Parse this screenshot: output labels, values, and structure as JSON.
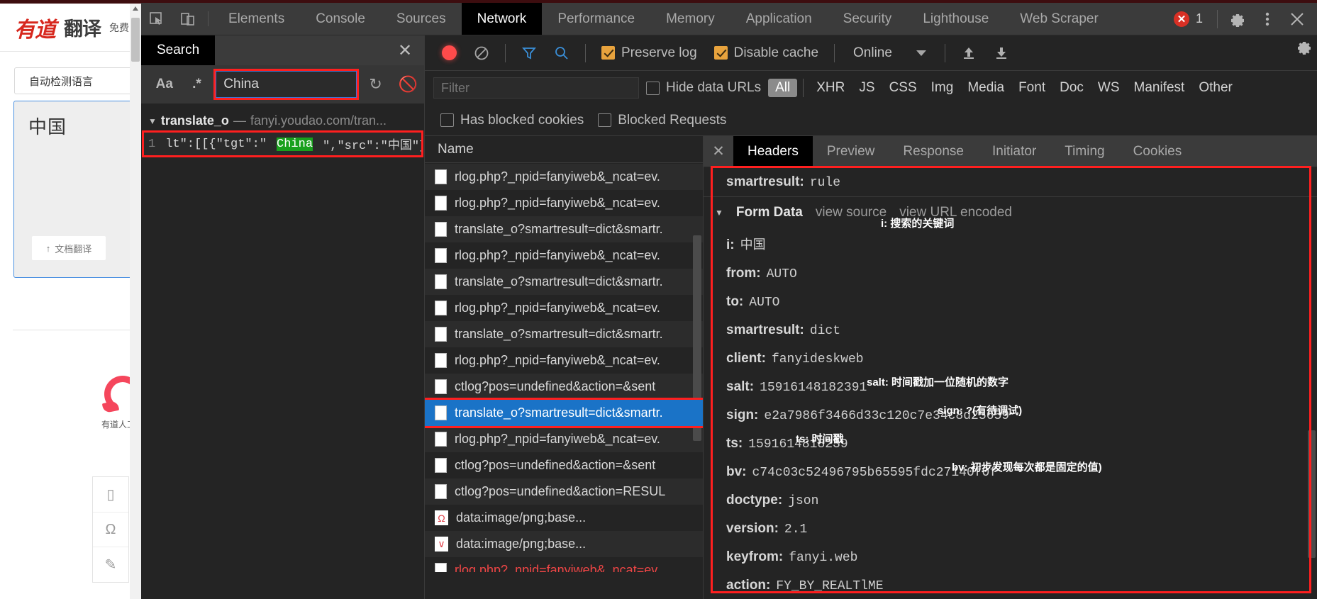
{
  "translate_page": {
    "logo_brand": "有道",
    "logo_word": "翻译",
    "logo_sub": "免费",
    "language_select": "自动检测语言",
    "source_text": "中国",
    "doc_translate_label": "文档翻译",
    "doc_translate_icon": "upload-icon",
    "human_translate_label": "有道人工翻",
    "side_tools": [
      "phone-icon",
      "headset-icon",
      "edit-icon"
    ]
  },
  "devtools": {
    "inspect_icon": "inspect-element-icon",
    "device_icon": "device-toolbar-icon",
    "tabs": [
      {
        "label": "Elements",
        "active": false
      },
      {
        "label": "Console",
        "active": false
      },
      {
        "label": "Sources",
        "active": false
      },
      {
        "label": "Network",
        "active": true
      },
      {
        "label": "Performance",
        "active": false
      },
      {
        "label": "Memory",
        "active": false
      },
      {
        "label": "Application",
        "active": false
      },
      {
        "label": "Security",
        "active": false
      },
      {
        "label": "Lighthouse",
        "active": false
      },
      {
        "label": "Web Scraper",
        "active": false
      }
    ],
    "error_count": "1",
    "settings_icon": "gear-icon",
    "more_icon": "kebab-menu-icon",
    "close_icon": "close-icon"
  },
  "search_panel": {
    "title": "Search",
    "close_icon": "close-icon",
    "match_case_label": "Aa",
    "regex_label": ".*",
    "query": "China",
    "placeholder": "",
    "refresh_icon": "refresh-icon",
    "clear_icon": "clear-icon",
    "result_file": "translate_o",
    "result_dash": "—",
    "result_url": "fanyi.youdao.com/tran...",
    "result_line_no": "1",
    "result_code_prefix": "lt\":[[{\"tgt\":\"",
    "result_match": "China",
    "result_code_suffix": "\",\"src\":\"中国\"}]],\""
  },
  "network": {
    "record_icon": "record-stop-icon",
    "clear_icon": "clear-icon",
    "filter_icon": "funnel-icon",
    "search_icon": "search-icon",
    "preserve_log_label": "Preserve log",
    "preserve_log_checked": true,
    "disable_cache_label": "Disable cache",
    "disable_cache_checked": true,
    "throttle_value": "Online",
    "import_icon": "upload-har-icon",
    "export_icon": "download-har-icon",
    "filter_placeholder": "Filter",
    "filter_value": "",
    "hide_data_urls_label": "Hide data URLs",
    "hide_data_urls_checked": false,
    "types": [
      "All",
      "XHR",
      "JS",
      "CSS",
      "Img",
      "Media",
      "Font",
      "Doc",
      "WS",
      "Manifest",
      "Other"
    ],
    "selected_type": "All",
    "has_blocked_cookies_label": "Has blocked cookies",
    "has_blocked_cookies_checked": false,
    "blocked_requests_label": "Blocked Requests",
    "blocked_requests_checked": false,
    "column_name": "Name",
    "requests": [
      {
        "name": "rlog.php?_npid=fanyiweb&_ncat=ev.",
        "icon": "doc-icon",
        "selected": false,
        "error": false
      },
      {
        "name": "rlog.php?_npid=fanyiweb&_ncat=ev.",
        "icon": "doc-icon",
        "selected": false,
        "error": false
      },
      {
        "name": "translate_o?smartresult=dict&smartr.",
        "icon": "doc-icon",
        "selected": false,
        "error": false
      },
      {
        "name": "rlog.php?_npid=fanyiweb&_ncat=ev.",
        "icon": "doc-icon",
        "selected": false,
        "error": false
      },
      {
        "name": "translate_o?smartresult=dict&smartr.",
        "icon": "doc-icon",
        "selected": false,
        "error": false
      },
      {
        "name": "rlog.php?_npid=fanyiweb&_ncat=ev.",
        "icon": "doc-icon",
        "selected": false,
        "error": false
      },
      {
        "name": "translate_o?smartresult=dict&smartr.",
        "icon": "doc-icon",
        "selected": false,
        "error": false
      },
      {
        "name": "rlog.php?_npid=fanyiweb&_ncat=ev.",
        "icon": "doc-icon",
        "selected": false,
        "error": false
      },
      {
        "name": "ctlog?pos=undefined&action=&sent",
        "icon": "doc-icon",
        "selected": false,
        "error": false
      },
      {
        "name": "translate_o?smartresult=dict&smartr.",
        "icon": "doc-icon",
        "selected": true,
        "error": false
      },
      {
        "name": "rlog.php?_npid=fanyiweb&_ncat=ev.",
        "icon": "doc-icon",
        "selected": false,
        "error": false
      },
      {
        "name": "ctlog?pos=undefined&action=&sent",
        "icon": "doc-icon",
        "selected": false,
        "error": false
      },
      {
        "name": "ctlog?pos=undefined&action=RESUL",
        "icon": "doc-icon",
        "selected": false,
        "error": false
      },
      {
        "name": "data:image/png;base...",
        "icon": "image-icon",
        "selected": false,
        "error": false
      },
      {
        "name": "data:image/png;base...",
        "icon": "image-icon",
        "selected": false,
        "error": false
      },
      {
        "name": "rlog.php?_npid=fanyiweb&_ncat=ev.",
        "icon": "doc-icon",
        "selected": false,
        "error": true
      }
    ]
  },
  "detail": {
    "close_icon": "close-icon",
    "tabs": [
      {
        "label": "Headers",
        "active": true
      },
      {
        "label": "Preview",
        "active": false
      },
      {
        "label": "Response",
        "active": false
      },
      {
        "label": "Initiator",
        "active": false
      },
      {
        "label": "Timing",
        "active": false
      },
      {
        "label": "Cookies",
        "active": false
      }
    ],
    "top_row": {
      "key": "smartresult:",
      "value": "rule"
    },
    "form_data": {
      "caret": "▼",
      "title": "Form Data",
      "view_source": "view source",
      "view_url_encoded": "view URL encoded",
      "rows": [
        {
          "key": "i:",
          "value": "中国",
          "note": "i: 搜索的关键词"
        },
        {
          "key": "from:",
          "value": "AUTO",
          "note": ""
        },
        {
          "key": "to:",
          "value": "AUTO",
          "note": ""
        },
        {
          "key": "smartresult:",
          "value": "dict",
          "note": ""
        },
        {
          "key": "client:",
          "value": "fanyideskweb",
          "note": ""
        },
        {
          "key": "salt:",
          "value": "15916148182391",
          "note": "salt: 时间戳加一位随机的数字"
        },
        {
          "key": "sign:",
          "value": "e2a7986f3466d33c120c7e34c8d25659",
          "note": "sign: ?(有待调试)"
        },
        {
          "key": "ts:",
          "value": "1591614818239",
          "note": "ts: 时间戳"
        },
        {
          "key": "bv:",
          "value": "c74c03c52496795b65595fdc27140f0f",
          "note": "bv: 初步发现每次都是固定的值)"
        },
        {
          "key": "doctype:",
          "value": "json",
          "note": ""
        },
        {
          "key": "version:",
          "value": "2.1",
          "note": ""
        },
        {
          "key": "keyfrom:",
          "value": "fanyi.web",
          "note": ""
        },
        {
          "key": "action:",
          "value": "FY_BY_REALTlME",
          "note": ""
        }
      ]
    },
    "settings_icon": "gear-icon"
  },
  "colors": {
    "accent_red": "#ff1f1f",
    "selection_blue": "#1a73c7",
    "highlight_green": "#18a01c",
    "brand_red": "#d7281e"
  }
}
